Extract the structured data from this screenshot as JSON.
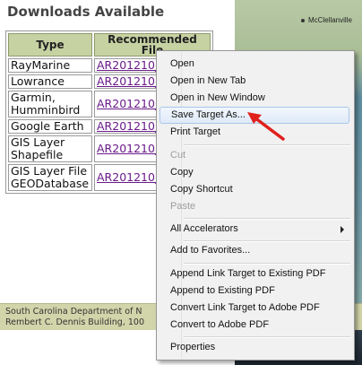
{
  "page": {
    "title": "Downloads Available",
    "table": {
      "headers": [
        "Type",
        "Recommended File"
      ],
      "rows": [
        {
          "type": "RayMarine",
          "file": "AR201210_..."
        },
        {
          "type": "Lowrance",
          "file": "AR201210_..."
        },
        {
          "type": "Garmin,\nHumminbird",
          "file": "AR201210_..."
        },
        {
          "type": "Google Earth",
          "file": "AR201210_..."
        },
        {
          "type": "GIS Layer\nShapefile",
          "file": "AR201210_..."
        },
        {
          "type": "GIS Layer File\nGEODatabase",
          "file": "AR201210_..."
        }
      ]
    },
    "map_label": "McClellanville",
    "footer": {
      "line1": "South Carolina Department of N",
      "line2": "Rembert C. Dennis Building, 100"
    }
  },
  "context_menu": {
    "items": [
      {
        "label": "Open",
        "state": "normal"
      },
      {
        "label": "Open in New Tab",
        "state": "normal"
      },
      {
        "label": "Open in New Window",
        "state": "normal"
      },
      {
        "label": "Save Target As...",
        "state": "highlighted"
      },
      {
        "label": "Print Target",
        "state": "normal"
      },
      {
        "label": "Cut",
        "state": "disabled"
      },
      {
        "label": "Copy",
        "state": "normal"
      },
      {
        "label": "Copy Shortcut",
        "state": "normal"
      },
      {
        "label": "Paste",
        "state": "disabled"
      },
      {
        "label": "All Accelerators",
        "state": "submenu"
      },
      {
        "label": "Add to Favorites...",
        "state": "normal"
      },
      {
        "label": "Append Link Target to Existing PDF",
        "state": "normal"
      },
      {
        "label": "Append to Existing PDF",
        "state": "normal"
      },
      {
        "label": "Convert Link Target to Adobe PDF",
        "state": "normal"
      },
      {
        "label": "Convert to Adobe PDF",
        "state": "normal"
      },
      {
        "label": "Properties",
        "state": "normal"
      }
    ]
  },
  "colors": {
    "table_header": "#c7d2a3",
    "link": "#6a1b8a",
    "menu_highlight": "#dfeaf8",
    "annotation_arrow": "#e0201c"
  }
}
